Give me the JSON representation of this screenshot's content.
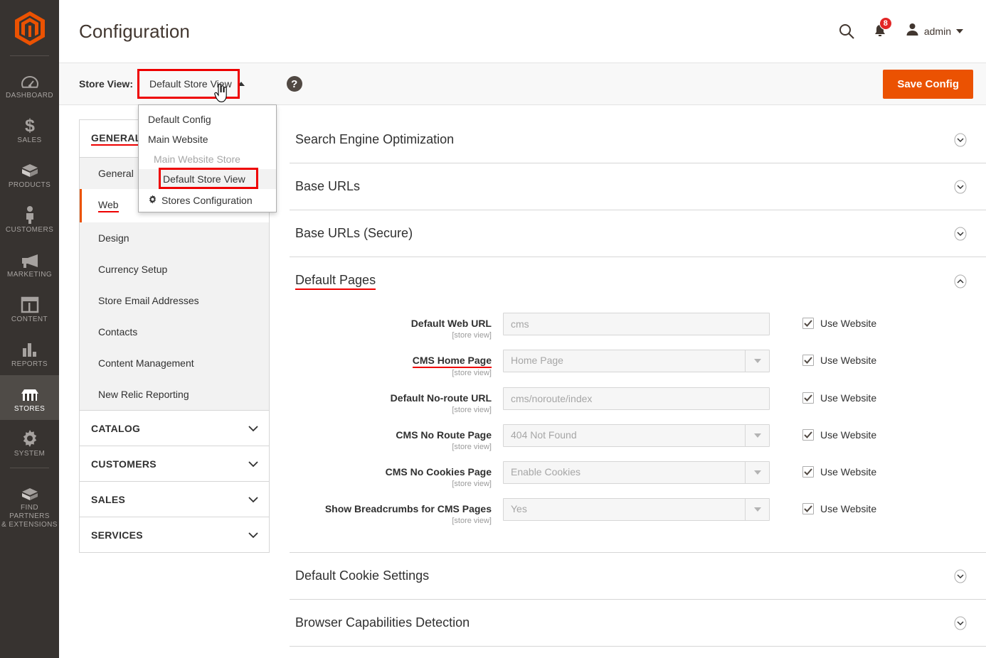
{
  "app": {
    "title": "Configuration",
    "logo_icon": "magento-logo-icon"
  },
  "header": {
    "search_icon": "search-icon",
    "notifications_icon": "bell-icon",
    "notifications_count": "8",
    "user_icon": "user-avatar-icon",
    "user_name": "admin",
    "user_caret_icon": "caret-down-icon"
  },
  "rail": {
    "items": [
      {
        "label": "DASHBOARD",
        "icon": "dashboard-gauge-icon",
        "active": false
      },
      {
        "label": "SALES",
        "icon": "dollar-sign-icon",
        "active": false
      },
      {
        "label": "PRODUCTS",
        "icon": "box-icon",
        "active": false
      },
      {
        "label": "CUSTOMERS",
        "icon": "person-icon",
        "active": false
      },
      {
        "label": "MARKETING",
        "icon": "megaphone-icon",
        "active": false
      },
      {
        "label": "CONTENT",
        "icon": "layout-icon",
        "active": false
      },
      {
        "label": "REPORTS",
        "icon": "bar-chart-icon",
        "active": false
      },
      {
        "label": "STORES",
        "icon": "storefront-icon",
        "active": true
      },
      {
        "label": "SYSTEM",
        "icon": "gear-icon",
        "active": false
      },
      {
        "label": "FIND PARTNERS\n& EXTENSIONS",
        "label_line1": "FIND PARTNERS",
        "label_line2": "& EXTENSIONS",
        "icon": "puzzle-block-icon",
        "active": false
      }
    ]
  },
  "switcher": {
    "label": "Store View:",
    "current": "Default Store View",
    "caret_icon": "caret-up-icon",
    "help_icon": "question-mark-icon",
    "save_label": "Save Config",
    "dropdown": {
      "open": true,
      "items": [
        {
          "label": "Default Config",
          "type": "item",
          "selected": false
        },
        {
          "label": "Main Website",
          "type": "item",
          "selected": false
        },
        {
          "label": "Main Website Store",
          "type": "group",
          "selected": false
        },
        {
          "label": "Default Store View",
          "type": "sub",
          "selected": true
        },
        {
          "label": "Stores Configuration",
          "type": "footer",
          "icon": "gear-icon",
          "selected": false
        }
      ]
    }
  },
  "cfg_nav": {
    "groups": [
      {
        "title": "GENERAL",
        "expanded": true,
        "highlighted": true,
        "items": [
          {
            "label": "General",
            "active": false,
            "highlighted": false
          },
          {
            "label": "Web",
            "active": true,
            "highlighted": true
          },
          {
            "label": "Design",
            "active": false,
            "highlighted": false
          },
          {
            "label": "Currency Setup",
            "active": false,
            "highlighted": false
          },
          {
            "label": "Store Email Addresses",
            "active": false,
            "highlighted": false
          },
          {
            "label": "Contacts",
            "active": false,
            "highlighted": false
          },
          {
            "label": "Content Management",
            "active": false,
            "highlighted": false
          },
          {
            "label": "New Relic Reporting",
            "active": false,
            "highlighted": false
          }
        ]
      },
      {
        "title": "CATALOG",
        "expanded": false,
        "highlighted": false,
        "items": []
      },
      {
        "title": "CUSTOMERS",
        "expanded": false,
        "highlighted": false,
        "items": []
      },
      {
        "title": "SALES",
        "expanded": false,
        "highlighted": false,
        "items": []
      },
      {
        "title": "SERVICES",
        "expanded": false,
        "highlighted": false,
        "items": []
      }
    ]
  },
  "sections": [
    {
      "title": "Search Engine Optimization",
      "expanded": false,
      "highlighted": false,
      "toggle_icon": "chevron-down-circle-icon"
    },
    {
      "title": "Base URLs",
      "expanded": false,
      "highlighted": false,
      "toggle_icon": "chevron-down-circle-icon"
    },
    {
      "title": "Base URLs (Secure)",
      "expanded": false,
      "highlighted": false,
      "toggle_icon": "chevron-down-circle-icon"
    },
    {
      "title": "Default Pages",
      "expanded": true,
      "highlighted": true,
      "toggle_icon": "chevron-up-circle-icon"
    },
    {
      "title": "Default Cookie Settings",
      "expanded": false,
      "highlighted": false,
      "toggle_icon": "chevron-down-circle-icon"
    },
    {
      "title": "Browser Capabilities Detection",
      "expanded": false,
      "highlighted": false,
      "toggle_icon": "chevron-down-circle-icon"
    }
  ],
  "default_pages_fields": [
    {
      "label": "Default Web URL",
      "scope": "[store view]",
      "control": "text",
      "value": "cms",
      "disabled": true,
      "highlighted": false,
      "inherit_label": "Use Website",
      "inherit_checked": true
    },
    {
      "label": "CMS Home Page",
      "scope": "[store view]",
      "control": "select",
      "value": "Home Page",
      "disabled": true,
      "highlighted": true,
      "inherit_label": "Use Website",
      "inherit_checked": true
    },
    {
      "label": "Default No-route URL",
      "scope": "[store view]",
      "control": "text",
      "value": "cms/noroute/index",
      "disabled": true,
      "highlighted": false,
      "inherit_label": "Use Website",
      "inherit_checked": true
    },
    {
      "label": "CMS No Route Page",
      "scope": "[store view]",
      "control": "select",
      "value": "404 Not Found",
      "disabled": true,
      "highlighted": false,
      "inherit_label": "Use Website",
      "inherit_checked": true
    },
    {
      "label": "CMS No Cookies Page",
      "scope": "[store view]",
      "control": "select",
      "value": "Enable Cookies",
      "disabled": true,
      "highlighted": false,
      "inherit_label": "Use Website",
      "inherit_checked": true
    },
    {
      "label": "Show Breadcrumbs for CMS Pages",
      "scope": "[store view]",
      "control": "select",
      "value": "Yes",
      "disabled": true,
      "highlighted": false,
      "inherit_label": "Use Website",
      "inherit_checked": true
    }
  ],
  "colors": {
    "accent_orange": "#eb5202",
    "rail_bg": "#373330",
    "rail_active_bg": "#4f4b47",
    "annotation_red": "#ee0000",
    "badge_red": "#e22626"
  }
}
